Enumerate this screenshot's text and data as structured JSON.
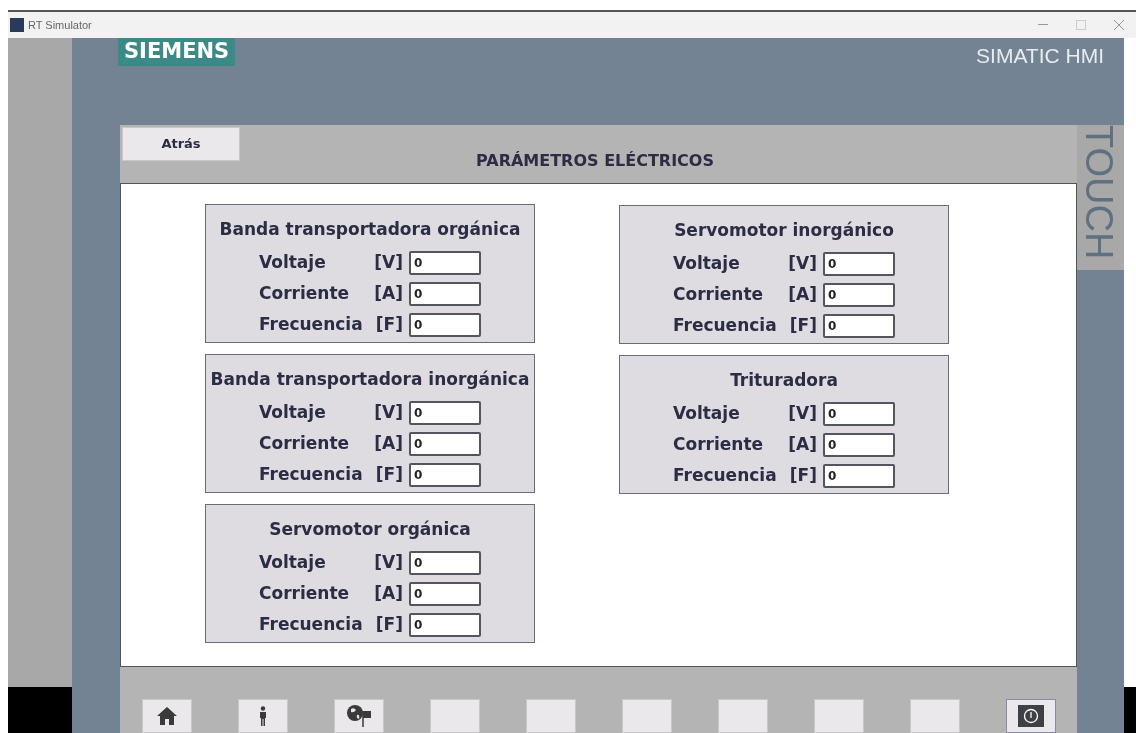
{
  "window": {
    "title": "RT Simulator"
  },
  "header": {
    "brand": "SIEMENS",
    "product": "SIMATIC HMI",
    "side_label": "TOUCH"
  },
  "back_button": "Atrás",
  "screen_title": "PARÁMETROS ELÉCTRICOS",
  "left_groups": [
    {
      "title": "Banda transportadora orgánica",
      "params": [
        {
          "name": "Voltaje",
          "unit": "[V]",
          "value": "0"
        },
        {
          "name": "Corriente",
          "unit": "[A]",
          "value": "0"
        },
        {
          "name": "Frecuencia",
          "unit": "[F]",
          "value": "0"
        }
      ]
    },
    {
      "title": "Banda transportadora inorgánica",
      "params": [
        {
          "name": "Voltaje",
          "unit": "[V]",
          "value": "0"
        },
        {
          "name": "Corriente",
          "unit": "[A]",
          "value": "0"
        },
        {
          "name": "Frecuencia",
          "unit": "[F]",
          "value": "0"
        }
      ]
    },
    {
      "title": "Servomotor orgánica",
      "params": [
        {
          "name": "Voltaje",
          "unit": "[V]",
          "value": "0"
        },
        {
          "name": "Corriente",
          "unit": "[A]",
          "value": "0"
        },
        {
          "name": "Frecuencia",
          "unit": "[F]",
          "value": "0"
        }
      ]
    }
  ],
  "right_groups": [
    {
      "title": "Servomotor inorgánico",
      "params": [
        {
          "name": "Voltaje",
          "unit": "[V]",
          "value": "0"
        },
        {
          "name": "Corriente",
          "unit": "[A]",
          "value": "0"
        },
        {
          "name": "Frecuencia",
          "unit": "[F]",
          "value": "0"
        }
      ]
    },
    {
      "title": "Trituradora",
      "params": [
        {
          "name": "Voltaje",
          "unit": "[V]",
          "value": "0"
        },
        {
          "name": "Corriente",
          "unit": "[A]",
          "value": "0"
        },
        {
          "name": "Frecuencia",
          "unit": "[F]",
          "value": "0"
        }
      ]
    }
  ],
  "function_keys": [
    {
      "kind": "home"
    },
    {
      "kind": "person"
    },
    {
      "kind": "globe"
    },
    {
      "kind": "blank"
    },
    {
      "kind": "blank"
    },
    {
      "kind": "blank"
    },
    {
      "kind": "blank"
    },
    {
      "kind": "blank"
    },
    {
      "kind": "blank"
    },
    {
      "kind": "power"
    }
  ]
}
